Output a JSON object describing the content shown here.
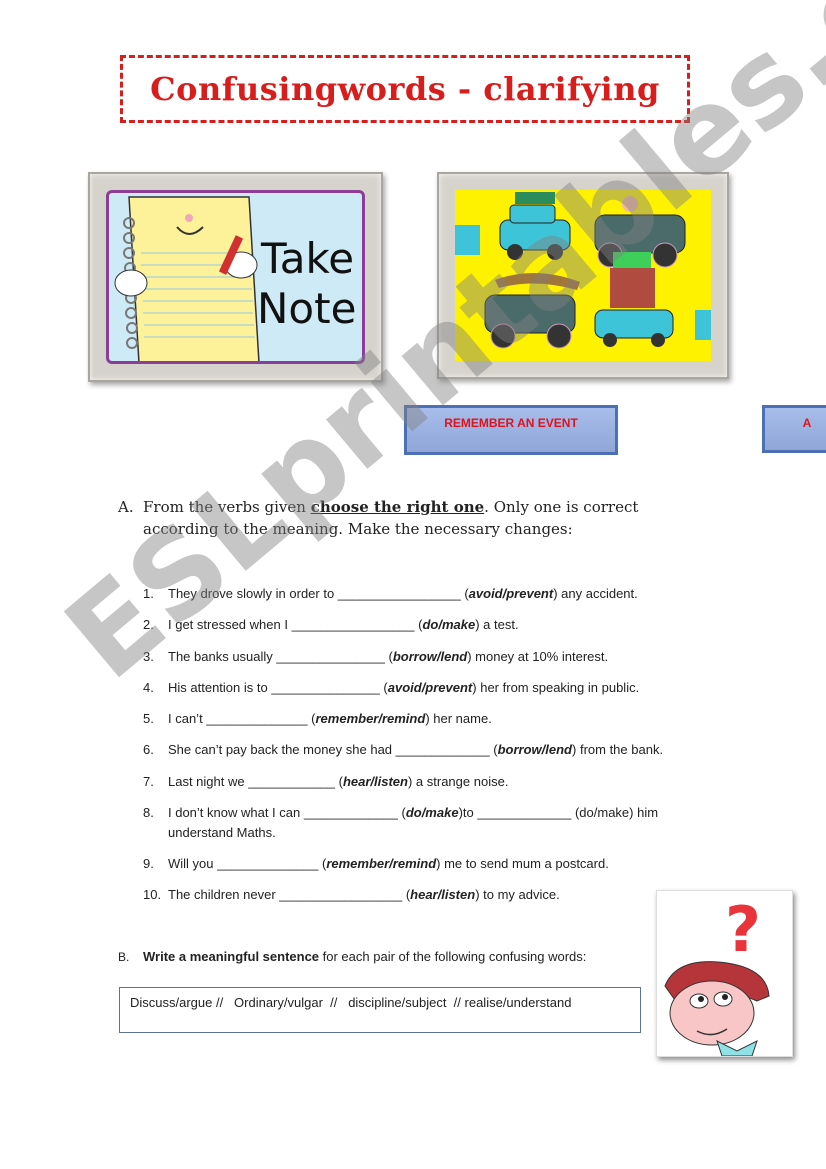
{
  "title": "Confusingwords - clarifying",
  "images": {
    "take_note": {
      "text_line1": "Take",
      "text_line2": "Note!"
    },
    "cars": {
      "description": "cartoon cars on road trip"
    },
    "thinker": {
      "description": "thinking boy with question mark",
      "symbol": "?"
    }
  },
  "buttons": [
    {
      "label": "REMEMBER AN EVENT"
    },
    {
      "label": "A"
    }
  ],
  "section_a": {
    "letter": "A.",
    "text_before": "From the verbs given ",
    "emphasis": "choose the right one",
    "text_after": ". Only one is correct according to the meaning. Make the necessary changes:"
  },
  "items": [
    {
      "num": "1.",
      "before": "They drove slowly in order to ",
      "blank": "_________________",
      "options": "avoid/prevent",
      "after": " any accident."
    },
    {
      "num": "2.",
      "before": "I get stressed when I ",
      "blank": "_________________",
      "options": "do/make",
      "after": " a test."
    },
    {
      "num": "3.",
      "before": "The banks usually ",
      "blank": "_______________",
      "options": "borrow/lend",
      "after": " money at 10% interest."
    },
    {
      "num": "4.",
      "before": "His attention is to ",
      "blank": "_______________",
      "options": "avoid/prevent",
      "after": " her from speaking in public."
    },
    {
      "num": "5.",
      "before": "I can’t ",
      "blank": "______________",
      "options": "remember/remind",
      "after": " her name."
    },
    {
      "num": "6.",
      "before": "She can’t pay back the money she had ",
      "blank": "_____________",
      "options": "borrow/lend",
      "after": " from the bank."
    },
    {
      "num": "7.",
      "before": "Last night we ",
      "blank": "____________",
      "options": "hear/listen",
      "after": " a strange noise."
    },
    {
      "num": "8.",
      "before": "I don’t know what I can ",
      "blank": "_____________",
      "options": "do/make",
      "after": "to _____________ (do/make) him understand Maths."
    },
    {
      "num": "9.",
      "before": "Will you ",
      "blank": "______________",
      "options": "remember/remind",
      "after": " me to send mum a postcard."
    },
    {
      "num": "10.",
      "before": "The children never ",
      "blank": "_________________",
      "options": "hear/listen",
      "after": " to my advice."
    }
  ],
  "section_b": {
    "letter": "B.",
    "emphasis": "Write a meaningful sentence",
    "text": " for each pair of the following confusing words:",
    "words": "Discuss/argue //   Ordinary/vulgar  //   discipline/subject  // realise/understand"
  },
  "watermark": "ESLprintables.com",
  "colors": {
    "title_red": "#d81d1d",
    "button_blue": "#8fa6d8",
    "button_border": "#4d6fb3",
    "button_text": "#e0121b"
  }
}
